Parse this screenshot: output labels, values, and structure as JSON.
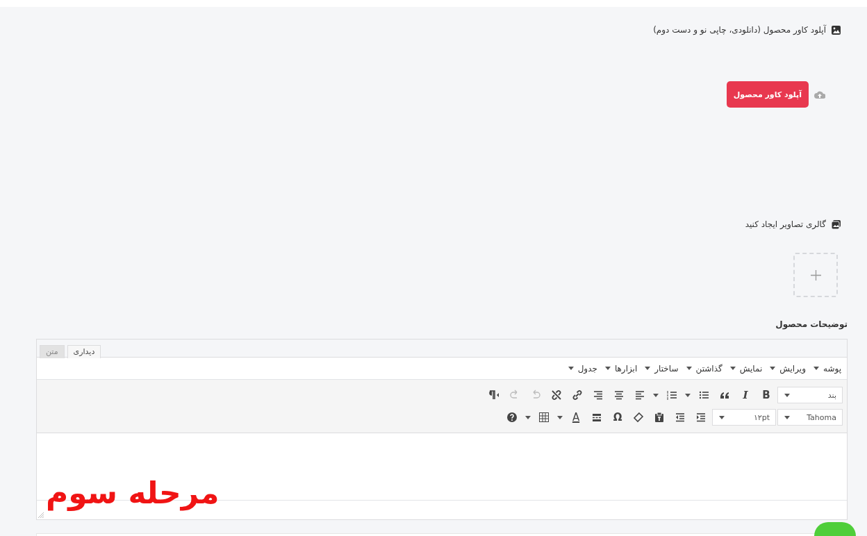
{
  "cover": {
    "title": "آپلود کاور محصول (دانلودی، چاپی نو و دست دوم)",
    "button": "آپلود کاور محصول"
  },
  "gallery": {
    "title": "گالری تصاویر ایجاد کنید"
  },
  "description": {
    "title": "توضیحات محصول",
    "tabs": [
      {
        "label": "دیداری",
        "selected": true
      },
      {
        "label": "متن",
        "selected": false
      }
    ],
    "menu": [
      "پوشه",
      "ویرایش",
      "نمایش",
      "گذاشتن",
      "ساختار",
      "ابزارها",
      "جدول"
    ],
    "format": "بند",
    "bold": "B",
    "italic": "I",
    "font": "Tahoma",
    "size": "۱۲pt",
    "text_color": "A",
    "special_char": "Ω",
    "undo": {
      "disabled": true
    },
    "redo": {
      "disabled": true
    }
  },
  "annotation": "مرحله سوم"
}
